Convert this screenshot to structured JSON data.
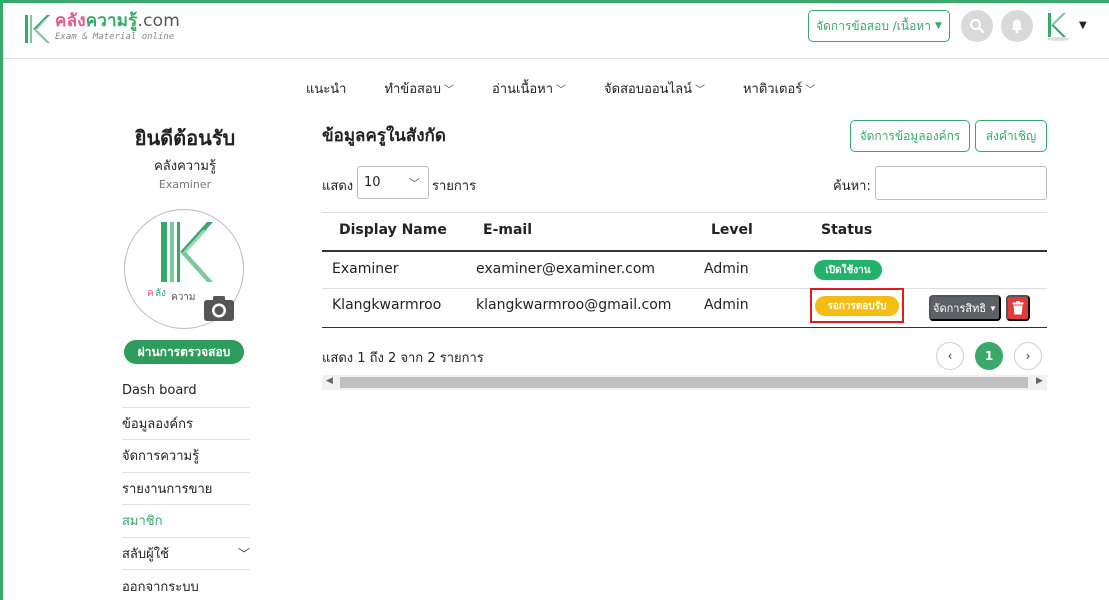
{
  "header": {
    "logo_main": "คลัง",
    "logo_mid": "ความรู้",
    "logo_end": ".com",
    "logo_sub": "Exam & Material online",
    "manage_button": "จัดการข้อสอบ /เนื้อหา"
  },
  "topnav": [
    {
      "label": "แนะนำ",
      "has_dropdown": false
    },
    {
      "label": "ทำข้อสอบ",
      "has_dropdown": true
    },
    {
      "label": "อ่านเนื้อหา",
      "has_dropdown": true
    },
    {
      "label": "จัดสอบออนไลน์",
      "has_dropdown": true
    },
    {
      "label": "หาติวเตอร์",
      "has_dropdown": true
    }
  ],
  "sidebar": {
    "welcome": "ยินดีต้อนรับ",
    "name": "คลังความรู้",
    "role": "Examiner",
    "verified_badge": "ผ่านการตรวจสอบ",
    "menu": [
      {
        "label": "Dash board",
        "active": false
      },
      {
        "label": "ข้อมูลองค์กร",
        "active": false
      },
      {
        "label": "จัดการความรู้",
        "active": false
      },
      {
        "label": "รายงานการขาย",
        "active": false
      },
      {
        "label": "สมาชิก",
        "active": true
      },
      {
        "label": "สลับผู้ใช้",
        "active": false,
        "has_dropdown": true
      },
      {
        "label": "ออกจากระบบ",
        "active": false
      }
    ]
  },
  "main": {
    "title": "ข้อมูลครูในสังกัด",
    "manage_org_button": "จัดการข้อมูลองค์กร",
    "invite_button": "ส่งคำเชิญ",
    "show_label": "แสดง",
    "page_size": "10",
    "items_label": "รายการ",
    "search_label": "ค้นหา:",
    "columns": [
      "Display Name",
      "E-mail",
      "Level",
      "Status"
    ],
    "rows": [
      {
        "name": "Examiner",
        "email": "examiner@examiner.com",
        "level": "Admin",
        "status": "เปิดใช้งาน"
      },
      {
        "name": "Klangkwarmroo",
        "email": "klangkwarmroo@gmail.com",
        "level": "Admin",
        "status": "รอการตอบรับ"
      }
    ],
    "permission_button": "จัดการสิทธิ",
    "summary": "แสดง 1 ถึง 2 จาก 2 รายการ",
    "current_page": "1",
    "prev_symbol": "‹",
    "next_symbol": "›"
  },
  "colors": {
    "brand_green": "#3aa86b",
    "status_active": "#22b36b",
    "status_pending": "#f3bd14",
    "danger": "#e23b3b",
    "highlight": "#e01b1b"
  }
}
